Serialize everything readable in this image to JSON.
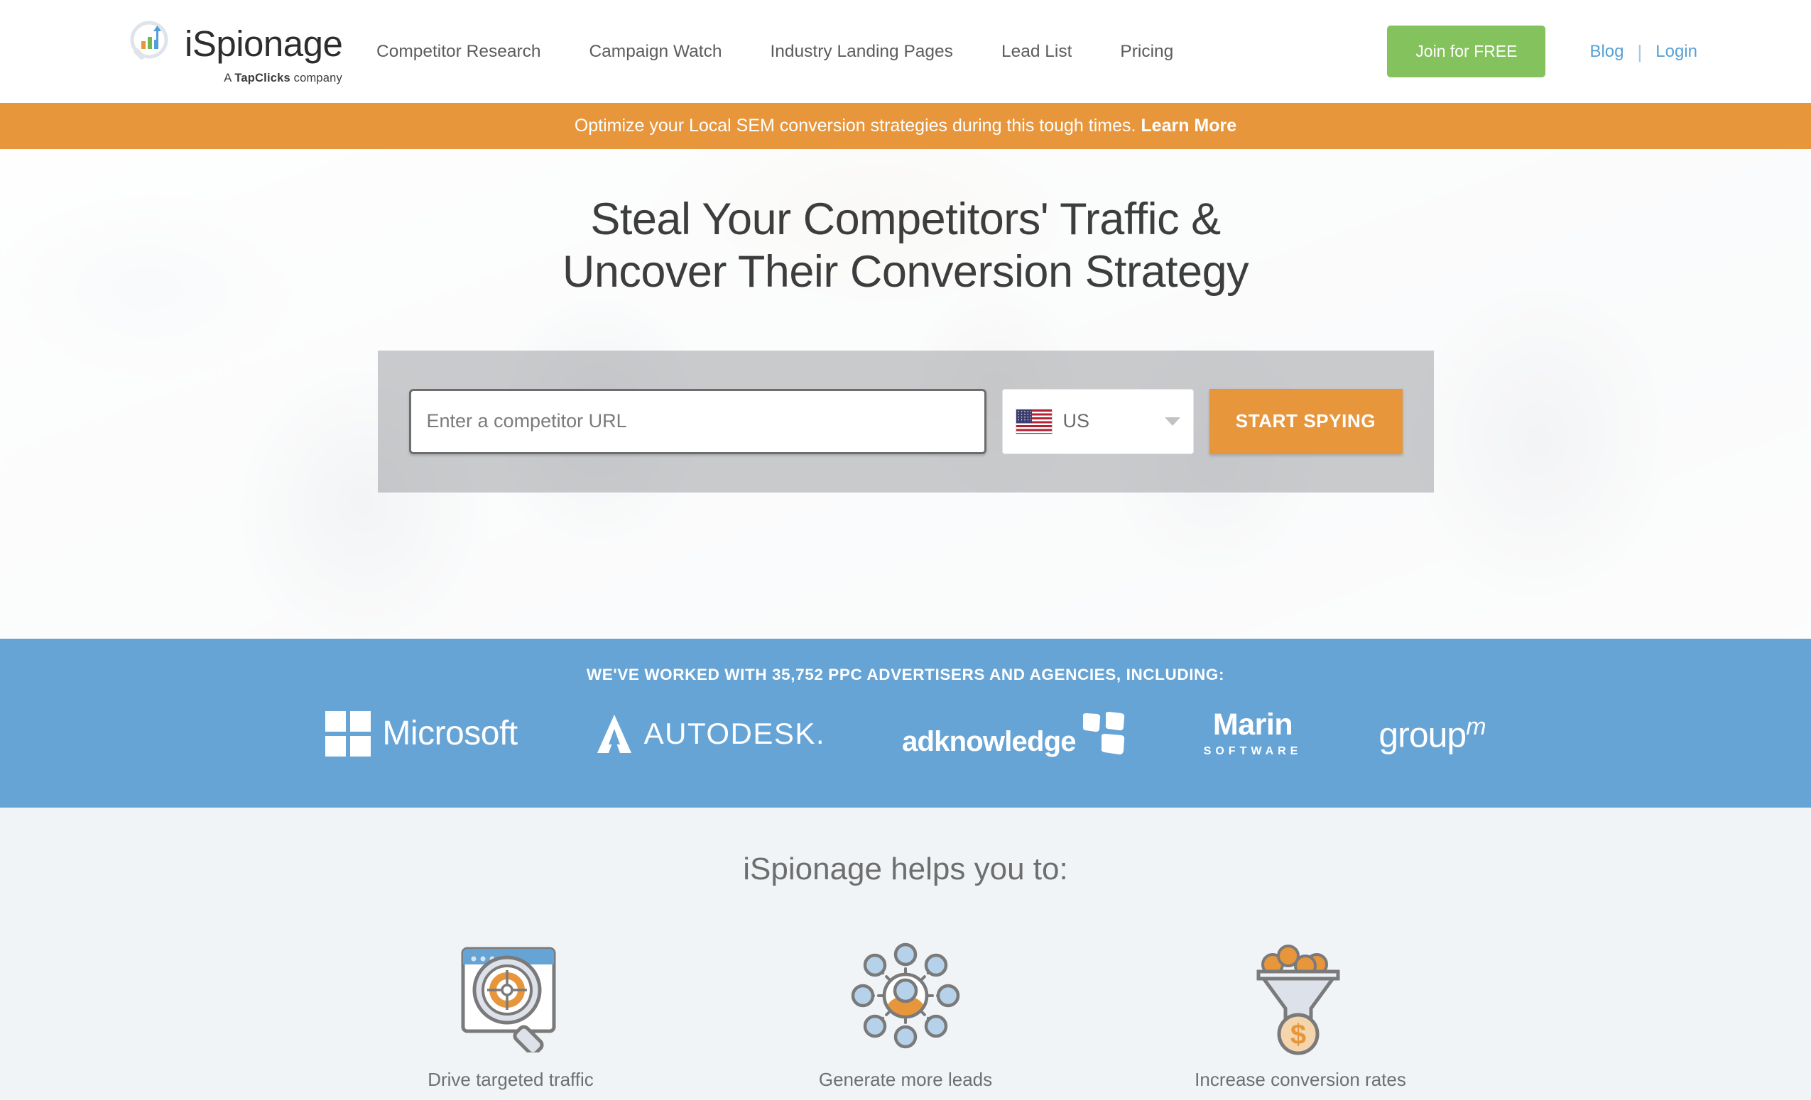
{
  "header": {
    "logo": {
      "icon": "magnifier-bar-chart-logo-icon",
      "wordmark": "iSpionage",
      "tagline_prefix": "A ",
      "tagline_brand": "TapClicks",
      "tagline_suffix": " company"
    },
    "nav": [
      {
        "label": "Competitor Research"
      },
      {
        "label": "Campaign Watch"
      },
      {
        "label": "Industry Landing Pages"
      },
      {
        "label": "Lead List"
      },
      {
        "label": "Pricing"
      }
    ],
    "join_label": "Join for FREE",
    "blog_label": "Blog",
    "login_label": "Login",
    "separator": "|"
  },
  "promo": {
    "text": "Optimize your Local SEM conversion strategies during this tough times. ",
    "link_label": "Learn More",
    "bg_color": "#e8963c"
  },
  "hero": {
    "title_line1": "Steal Your Competitors' Traffic &",
    "title_line2": "Uncover Their Conversion Strategy",
    "search": {
      "placeholder": "Enter a competitor URL",
      "value": "",
      "country_code": "US",
      "country_flag": "us-flag-icon",
      "submit_label": "START SPYING",
      "submit_color": "#e8963c"
    }
  },
  "clients": {
    "title": "WE'VE WORKED WITH 35,752 PPC ADVERTISERS AND AGENCIES, INCLUDING:",
    "bg_color": "#67a4d6",
    "logos": [
      {
        "name": "Microsoft",
        "primary": "Microsoft",
        "secondary": ""
      },
      {
        "name": "Autodesk",
        "primary": "AUTODESK",
        "secondary": "."
      },
      {
        "name": "adknowledge",
        "primary": "adknowledge",
        "secondary": ""
      },
      {
        "name": "Marin Software",
        "primary": "Marin",
        "secondary": "SOFTWARE"
      },
      {
        "name": "groupm",
        "primary": "group",
        "secondary": "m"
      }
    ]
  },
  "helps": {
    "title": "iSpionage helps you to:",
    "bg_color": "#f0f4f7",
    "features": [
      {
        "icon": "browser-magnifier-target-icon",
        "label": "Drive targeted traffic"
      },
      {
        "icon": "network-people-leads-icon",
        "label": "Generate more leads"
      },
      {
        "icon": "funnel-coin-conversion-icon",
        "label": "Increase conversion rates"
      }
    ]
  }
}
